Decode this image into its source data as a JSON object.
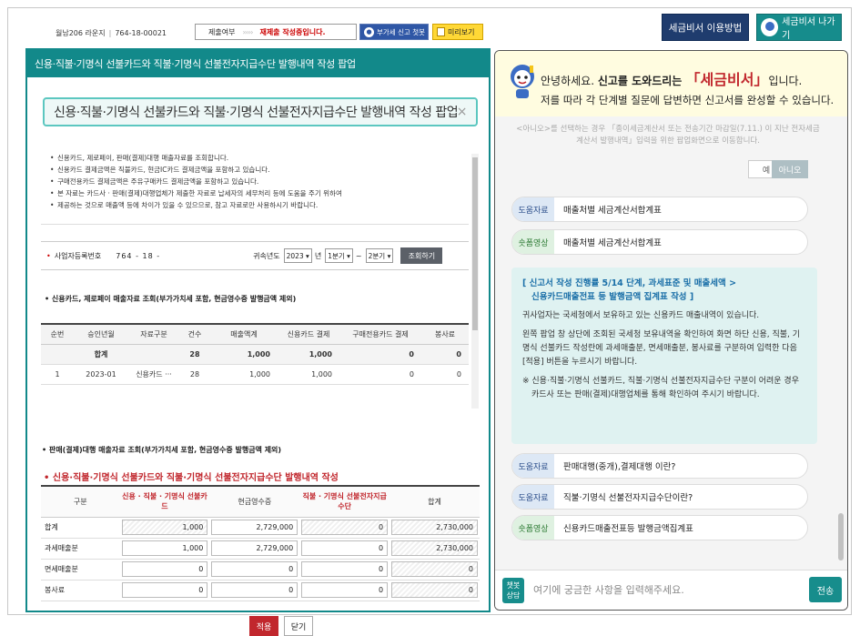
{
  "topbar": {
    "user_name": "월남206 라운지",
    "biz_no": "764-18-00021",
    "status_label": "제출여부",
    "status_value": "재제출 작성중입니다.",
    "tax_button": "부가세 신고 첫봇",
    "preview_button": "미리보기"
  },
  "top_right": {
    "howto_button": "세금비서 이용방법",
    "exit_button": "세금비서 나가기"
  },
  "left": {
    "header": "신용·직불·기명식 선불카드와 직불·기명식 선불전자지급수단 발행내역 작성 팝업",
    "popup_title": "신용·직불·기명식 선불카드와 직불·기명식 선불전자지급수단 발행내역 작성 팝업",
    "notes": [
      "신용카드, 제로페이, 판매(결제)대행 매출자료를 조회합니다.",
      "신용카드 결제금액은 직불카드, 현금IC카드 결제금액을 포함하고 있습니다.",
      "구매전용카드 결제금액은 주유구매카드 결제금액을 포함하고 있습니다.",
      "본 자료는 카드사 · 판매(결제)대행업체가 제출한 자료로 납세자의 세무처리 등에 도움을 주기 위하여",
      "제공하는 것으로 매출액 등에 차이가 있을 수 있으므로, 참고 자료로만 사용하시기 바랍니다."
    ],
    "biz_label": "사업자등록번호",
    "biz_number": "764 - 18 -",
    "year_label": "귀속년도",
    "year_value": "2023",
    "year_unit": "년",
    "period_from": "1분기",
    "period_sep": "~",
    "period_to": "2분기",
    "query_button": "조회하기",
    "section1": "신용카드, 제로페이 매출자료 조회(부가가치세 포함, 현금영수증 발행금액 제외)",
    "table1": {
      "headers": [
        "순번",
        "승인년월",
        "자료구분",
        "건수",
        "매출액계",
        "신용카드 결제",
        "구매전용카드 결제",
        "봉사료"
      ],
      "sum_row": [
        "",
        "합계",
        "",
        "28",
        "1,000",
        "1,000",
        "0",
        "0"
      ],
      "rows": [
        [
          "1",
          "2023-01",
          "신용카드 ···",
          "28",
          "1,000",
          "1,000",
          "0",
          "0"
        ]
      ]
    },
    "section2": "판매(결제)대행 매출자료 조회(부가가치세 포함, 현금영수증 발행금액 제외)",
    "section3": "신용·직불·기명식 선불카드와 직불·기명식 선불전자지급수단 발행내역 작성",
    "table2": {
      "headers": [
        "구분",
        "신용 · 직불 · 기명식 선불카드",
        "현금영수증",
        "직불 · 기명식 선불전자지급수단",
        "합계"
      ],
      "rows": [
        {
          "label": "합계",
          "card": "1,000",
          "cash": "2,729,000",
          "epay": "0",
          "total": "2,730,000"
        },
        {
          "label": "과세매출분",
          "card": "1,000",
          "cash": "2,729,000",
          "epay": "0",
          "total": "2,730,000"
        },
        {
          "label": "면세매출분",
          "card": "0",
          "cash": "0",
          "epay": "0",
          "total": "0"
        },
        {
          "label": "봉사료",
          "card": "0",
          "cash": "0",
          "epay": "0",
          "total": "0"
        }
      ]
    },
    "apply_button": "적용",
    "close_button": "닫기"
  },
  "chat": {
    "greet_pre": "안녕하세요. ",
    "greet_bold": "신고를 도와드리는 ",
    "greet_brand": "「세금비서」",
    "greet_post": "입니다.",
    "greet_line2": "저를 따라 각 단계별 질문에 답변하면 신고서를 완성할 수 있습니다.",
    "faded_text": "<아니오>를 선택하는 경우 「종이세금계산서 또는 전송기간 마감일(7.11.) 이 지난 전자세금계산서 발행내역」입력을 위한 팝업화면으로 이동합니다.",
    "yes": "예",
    "no": "아니오",
    "chips_top": [
      {
        "tag": "도움자료",
        "kind": "doc",
        "text": "매출처별 세금계산서합계표"
      },
      {
        "tag": "숏폼영상",
        "kind": "vid",
        "text": "매출처별 세금계산서합계표"
      }
    ],
    "message": {
      "heading1": "[ 신고서 작성 진행률 5/14 단계, 과세표준 및 매출세액 >",
      "heading2": "신용카드매출전표 등 발행금액 집계표 작성 ]",
      "p1": "귀사업자는 국세청에서 보유하고 있는 신용카드 매출내역이 있습니다.",
      "p2": "왼쪽 팝업 창 상단에 조회된 국세청 보유내역을 확인하여 화면 하단 신용, 직불, 기명식 선불카드 작성란에 과세매출분, 면세매출분, 봉사료를 구분하여 입력한 다음 [적용] 버튼을 누르시기 바랍니다.",
      "p3": "※ 신용·직불·기명식 선불카드, 직불·기명식 선불전자지급수단 구분이 어려운 경우 카드사 또는 판매(결제)대행업체를 통해 확인하여 주시기 바랍니다."
    },
    "chips_bottom": [
      {
        "tag": "도움자료",
        "kind": "doc",
        "text": "판매대행(중개),결제대행 이란?"
      },
      {
        "tag": "도움자료",
        "kind": "doc",
        "text": "직불·기명식 선불전자지급수단이란?"
      },
      {
        "tag": "숏폼영상",
        "kind": "vid",
        "text": "신용카드매출전표등 발행금액집계표"
      }
    ],
    "bot_label": "챗봇 상담",
    "input_placeholder": "여기에 궁금한 사항을 입력해주세요.",
    "send_button": "전송"
  }
}
